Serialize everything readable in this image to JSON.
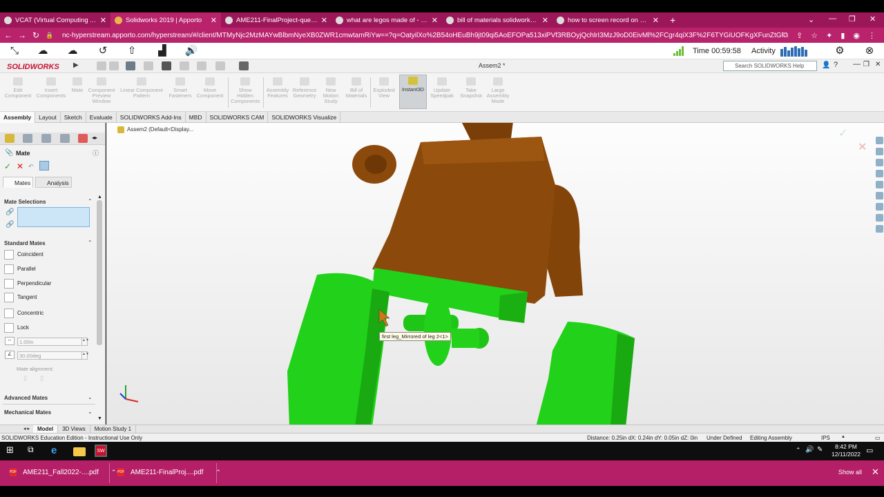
{
  "browser": {
    "tabs": [
      {
        "label": "VCAT (Virtual Computing Access",
        "active": false
      },
      {
        "label": "Solidworks 2019 | Apporto",
        "active": true
      },
      {
        "label": "AME211-FinalProject-questions.",
        "active": false
      },
      {
        "label": "what are legos made of - Google",
        "active": false
      },
      {
        "label": "bill of materials solidworks - Goo",
        "active": false
      },
      {
        "label": "how to screen record on hp envy",
        "active": false
      }
    ],
    "url": "nc-hyperstream.apporto.com/hyperstream/#/client/MTMyNjc2MzMAYwBlbmNyeXB0ZWR1cmwtamRiYw==?q=OatyilXo%2B54oHEuBh9jt09qi5AoEFOPa513xiPVf3RBOyjQchlrI3MzJ9oD0EivMl%2FCgr4qiX3F%2F6TYGiUOFKgXFunZtGl38ppMDaJVYPH..."
  },
  "apporto": {
    "time_label": "Time 00:59:58",
    "activity_label": "Activity"
  },
  "solidworks": {
    "logo_text": "SOLIDWORKS",
    "doc_title": "Assem2 *",
    "search_placeholder": "Search SOLIDWORKS Help",
    "commands": [
      {
        "label": "Edit Component",
        "enabled": false
      },
      {
        "label": "Insert Components",
        "enabled": false
      },
      {
        "label": "Mate",
        "enabled": false
      },
      {
        "label": "Component Preview Window",
        "enabled": false
      },
      {
        "label": "Linear Component Pattern",
        "enabled": false
      },
      {
        "label": "Smart Fasteners",
        "enabled": false
      },
      {
        "label": "Move Component",
        "enabled": false
      },
      {
        "label": "Show Hidden Components",
        "enabled": false
      },
      {
        "label": "Assembly Features",
        "enabled": false
      },
      {
        "label": "Reference Geometry",
        "enabled": false
      },
      {
        "label": "New Motion Study",
        "enabled": false
      },
      {
        "label": "Bill of Materials",
        "enabled": false
      },
      {
        "label": "Exploded View",
        "enabled": false
      },
      {
        "label": "Instant3D",
        "enabled": true
      },
      {
        "label": "Update Speedpak",
        "enabled": false
      },
      {
        "label": "Take Snapshot",
        "enabled": false
      },
      {
        "label": "Large Assembly Mode",
        "enabled": false
      }
    ],
    "command_tabs": [
      "Assembly",
      "Layout",
      "Sketch",
      "Evaluate",
      "SOLIDWORKS Add-Ins",
      "MBD",
      "SOLIDWORKS CAM",
      "SOLIDWORKS Visualize"
    ],
    "active_command_tab": "Assembly",
    "tree_label": "Assem2  (Default<Display..."
  },
  "property_manager": {
    "title": "Mate",
    "subtabs": [
      "Mates",
      "Analysis"
    ],
    "mate_selections_header": "Mate Selections",
    "standard_mates_header": "Standard Mates",
    "standard_mates": [
      "Coincident",
      "Parallel",
      "Perpendicular",
      "Tangent",
      "Concentric",
      "Lock"
    ],
    "distance_value": "1.00in",
    "angle_value": "30.00deg",
    "mate_alignment_label": "Mate alignment:",
    "advanced_mates_header": "Advanced Mates",
    "mechanical_mates_header": "Mechanical Mates"
  },
  "viewport": {
    "tooltip": "first leg_Mirrored of leg 2<1>",
    "colors": {
      "torso": "#8b4a0b",
      "legs": "#22d119"
    }
  },
  "bottom_tabs": [
    "Model",
    "3D Views",
    "Motion Study 1"
  ],
  "status_bar": {
    "edition": "SOLIDWORKS Education Edition - Instructional Use Only",
    "measurement": "Distance: 0.25in   dX: 0.24in  dY: 0.05in  dZ: 0in",
    "state": "Under Defined",
    "mode": "Editing Assembly",
    "units": "IPS"
  },
  "taskbar": {
    "time": "8:42 PM",
    "date": "12/11/2022"
  },
  "downloads": {
    "items": [
      "AME211_Fall2022-....pdf",
      "AME211-FinalProj....pdf"
    ],
    "show_all_label": "Show all"
  }
}
